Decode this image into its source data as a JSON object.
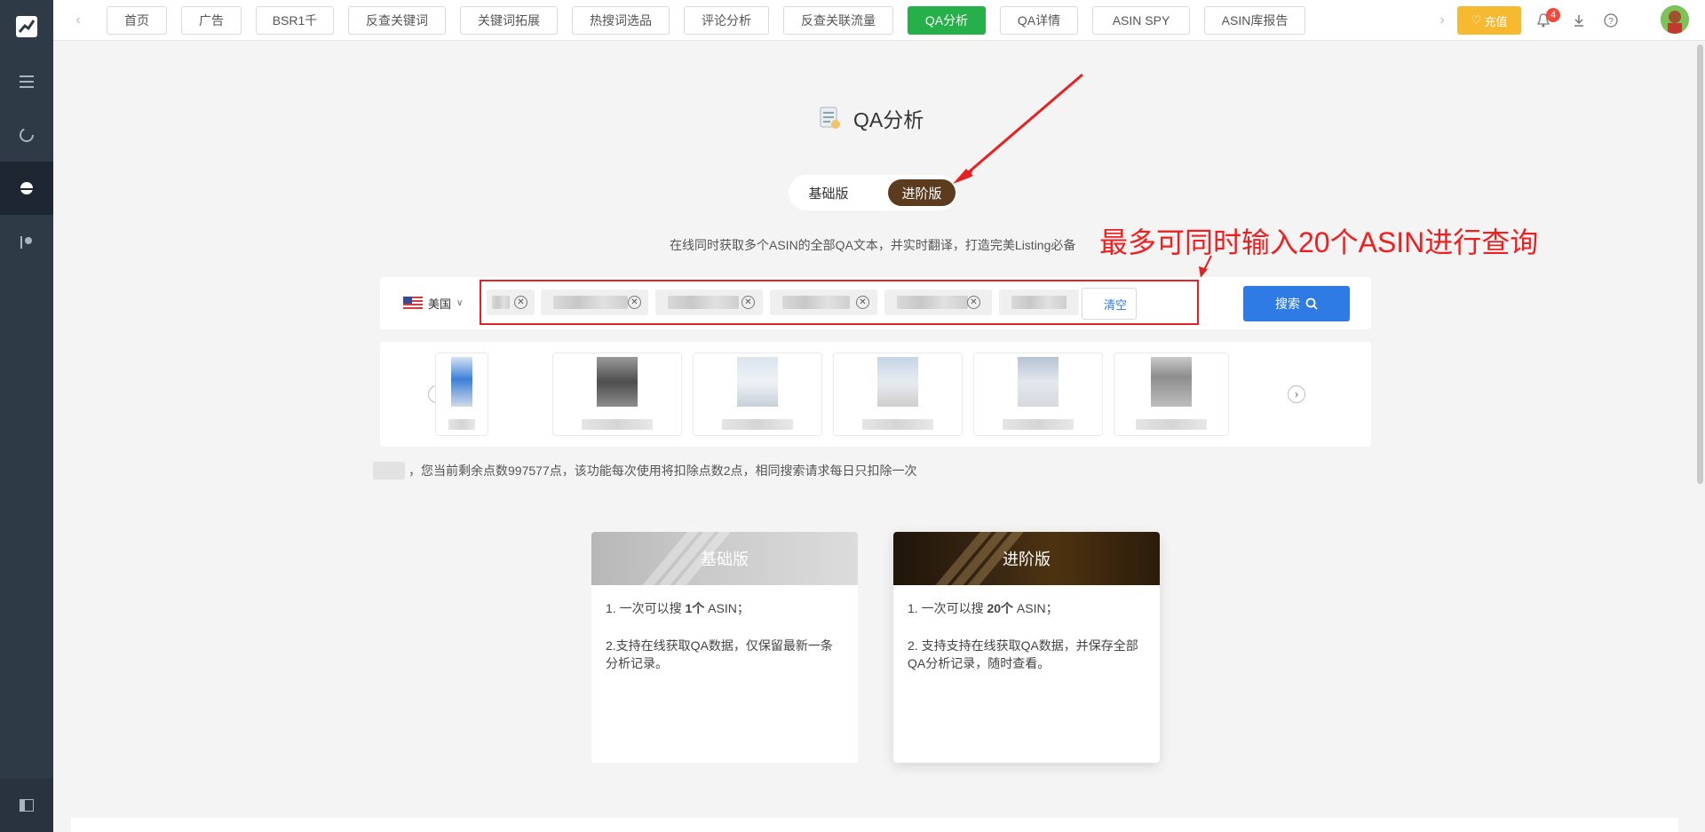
{
  "topbar": {
    "tabs": [
      {
        "label": "首页",
        "active": false
      },
      {
        "label": "广告",
        "active": false
      },
      {
        "label": "BSR1千",
        "active": false
      },
      {
        "label": "反查关键词",
        "active": false
      },
      {
        "label": "关键词拓展",
        "active": false
      },
      {
        "label": "热搜词选品",
        "active": false
      },
      {
        "label": "评论分析",
        "active": false
      },
      {
        "label": "反查关联流量",
        "active": false
      },
      {
        "label": "QA分析",
        "active": true
      },
      {
        "label": "QA详情",
        "active": false
      },
      {
        "label": "ASIN SPY",
        "active": false
      },
      {
        "label": "ASIN库报告",
        "active": false
      }
    ],
    "recharge_label": "充值",
    "notification_count": "4",
    "accent_green": "#27b04a"
  },
  "page": {
    "title": "QA分析",
    "version_basic": "基础版",
    "version_advanced": "进阶版",
    "description": "在线同时获取多个ASIN的全部QA文本，并实时翻译，打造完美Listing必备",
    "annotation": "最多可同时输入20个ASIN进行查询"
  },
  "search": {
    "region": "美国",
    "clear_label": "清空",
    "search_label": "搜索",
    "accent_blue": "#2e7be6"
  },
  "points_text": "，您当前剩余点数997577点，该功能每次使用将扣除点数2点，相同搜索请求每日只扣除一次",
  "plans": {
    "basic": {
      "title": "基础版",
      "line1_pre": "1. 一次可以搜 ",
      "line1_bold": "1个",
      "line1_post": " ASIN；",
      "line2": "2.支持在线获取QA数据，仅保留最新一条分析记录。"
    },
    "advanced": {
      "title": "进阶版",
      "line1_pre": "1. 一次可以搜 ",
      "line1_bold": "20个",
      "line1_post": " ASIN；",
      "line2": "2. 支持支持在线获取QA数据，并保存全部QA分析记录，随时查看。"
    }
  }
}
